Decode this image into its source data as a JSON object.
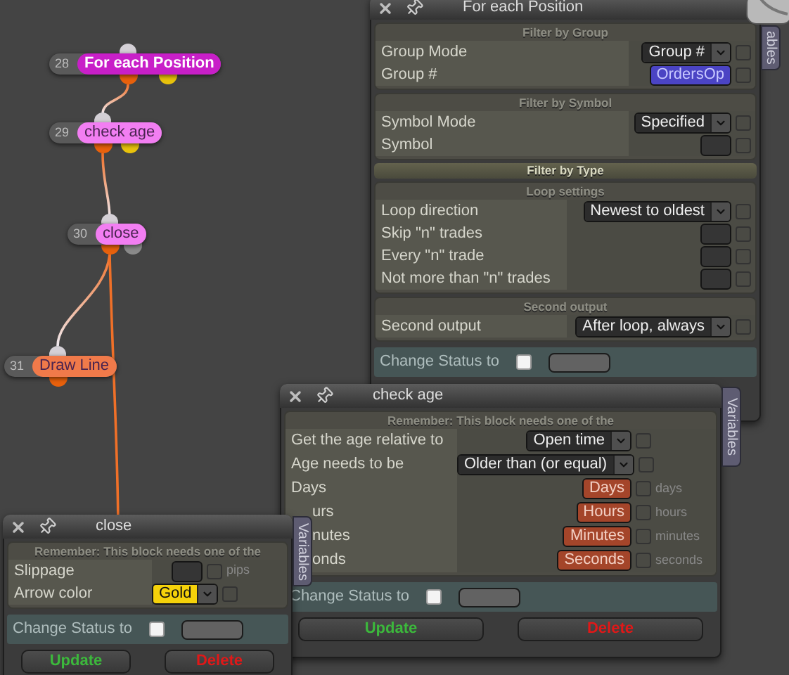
{
  "canvas": {
    "nodes": [
      {
        "number": "28",
        "label": "For each Position",
        "color": "#c81fc8",
        "selected": true,
        "ports": [
          {
            "color": "#e8610c"
          },
          {
            "color": "#e8c20c"
          }
        ]
      },
      {
        "number": "29",
        "label": "check age",
        "color": "#f27ef2",
        "selected": false,
        "ports": [
          {
            "color": "#e8610c"
          },
          {
            "color": "#e8c20c"
          }
        ]
      },
      {
        "number": "30",
        "label": "close",
        "color": "#f27ef2",
        "selected": false,
        "ports": [
          {
            "color": "#e8610c"
          },
          {
            "color": "#8a8a8a"
          }
        ]
      },
      {
        "number": "31",
        "label": "Draw Line",
        "color": "#f07a4a",
        "selected": false,
        "ports": [
          {
            "color": "#e8610c"
          }
        ]
      }
    ]
  },
  "windows": [
    {
      "title": "For each Position",
      "variables_tab": "ables",
      "sections": [
        {
          "heading": "Filter by Group",
          "kind": "panel",
          "rows": [
            {
              "label": "Group Mode",
              "kind": "dropdown",
              "value": "Group #",
              "checked": false
            },
            {
              "label": "Group #",
              "kind": "input",
              "value": "OrdersOp",
              "color": "#4b44c4",
              "checked": false
            }
          ]
        },
        {
          "heading": "Filter by Symbol",
          "kind": "panel",
          "rows": [
            {
              "label": "Symbol Mode",
              "kind": "dropdown",
              "value": "Specified",
              "checked": false
            },
            {
              "label": "Symbol",
              "kind": "input",
              "checked": false
            }
          ]
        },
        {
          "heading": "Filter by Type",
          "kind": "bar"
        },
        {
          "heading": "Loop settings",
          "kind": "panel",
          "rows": [
            {
              "label": "Loop direction",
              "kind": "dropdown",
              "value": "Newest to oldest",
              "checked": false
            },
            {
              "label": "Skip \"n\" trades",
              "kind": "input",
              "checked": false
            },
            {
              "label": "Every \"n\" trade",
              "kind": "input",
              "checked": false
            },
            {
              "label": "Not more than \"n\" trades",
              "kind": "input",
              "checked": false
            }
          ]
        },
        {
          "heading": "Second output",
          "kind": "panel",
          "rows": [
            {
              "label": "Second output",
              "kind": "dropdown",
              "value": "After loop, always",
              "checked": false
            }
          ]
        }
      ],
      "status": {
        "label": "Change Status to",
        "checked": false
      }
    },
    {
      "title": "check age",
      "variables_tab": "Variables",
      "sections": [
        {
          "heading": "Remember: This block needs one of the",
          "kind": "panel",
          "rows": [
            {
              "label": "Get the age relative to",
              "kind": "dropdown",
              "value": "Open time",
              "checked": false
            },
            {
              "label": "Age needs to be",
              "kind": "dropdown",
              "value": "Older than (or equal)",
              "checked": false
            },
            {
              "label": "Days",
              "kind": "input",
              "value": "Days",
              "color": "#a4452a",
              "checked": false,
              "unit": "days"
            },
            {
              "label": "urs",
              "kind": "input",
              "value": "Hours",
              "color": "#a4452a",
              "checked": false,
              "unit": "hours"
            },
            {
              "label": "nutes",
              "kind": "input",
              "value": "Minutes",
              "color": "#a4452a",
              "checked": false,
              "unit": "minutes"
            },
            {
              "label": "onds",
              "kind": "input",
              "value": "Seconds",
              "color": "#a4452a",
              "checked": false,
              "unit": "seconds"
            }
          ]
        }
      ],
      "status": {
        "label": "Change Status to",
        "checked": false
      },
      "buttons": [
        {
          "label": "Update",
          "color": "#3cb83c"
        },
        {
          "label": "Delete",
          "color": "#e01818"
        }
      ]
    },
    {
      "title": "close",
      "variables_tab": "Variables",
      "sections": [
        {
          "heading": "Remember: This block needs one of the",
          "kind": "panel",
          "rows": [
            {
              "label": "Slippage",
              "kind": "input",
              "checked": false,
              "unit": "pips"
            },
            {
              "label": "Arrow color",
              "kind": "dropdown",
              "value": "Gold",
              "color": "#f5d20a",
              "checked": false
            }
          ]
        }
      ],
      "status": {
        "label": "Change Status to",
        "checked": false
      },
      "buttons": [
        {
          "label": "Update",
          "color": "#3cb83c"
        },
        {
          "label": "Delete",
          "color": "#e01818"
        }
      ]
    }
  ]
}
